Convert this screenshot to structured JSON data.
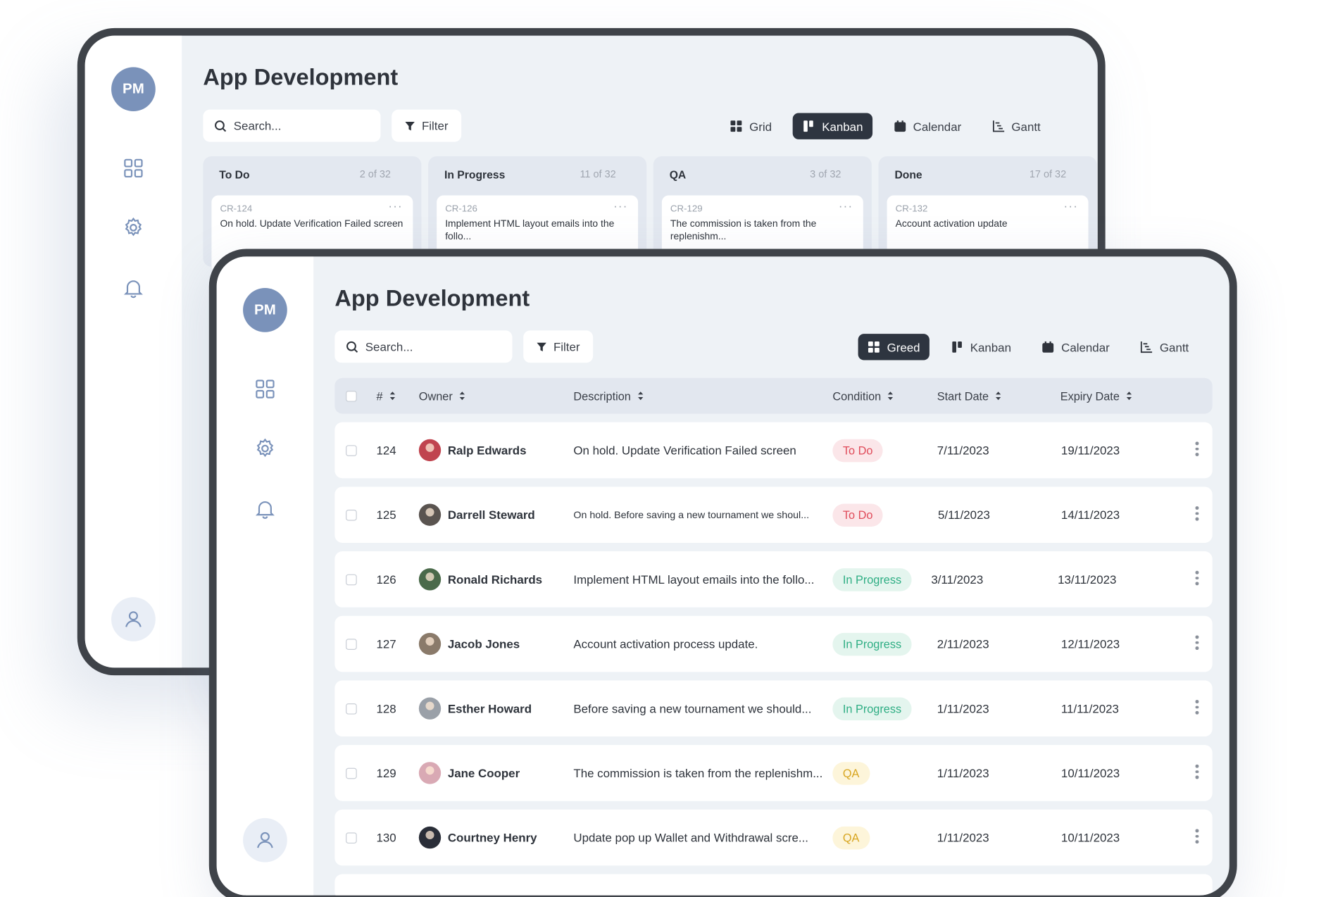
{
  "colors": {
    "frame": "#3f4349",
    "accent_avatar": "#7a92ba",
    "active_view": "#2e3540",
    "todo": "#e04b5a",
    "in_progress": "#2fae84",
    "qa": "#d8a621"
  },
  "back_window": {
    "avatar_initials": "PM",
    "title": "App Development",
    "search_placeholder": "Search...",
    "filter_label": "Filter",
    "views": [
      {
        "label": "Grid",
        "icon": "grid-icon",
        "active": false
      },
      {
        "label": "Kanban",
        "icon": "kanban-icon",
        "active": true
      },
      {
        "label": "Calendar",
        "icon": "calendar-icon",
        "active": false
      },
      {
        "label": "Gantt",
        "icon": "gantt-icon",
        "active": false
      }
    ],
    "columns": [
      {
        "title": "To Do",
        "count": "2 of 32",
        "card": {
          "id": "CR-124",
          "text": "On hold. Update Verification Failed screen"
        }
      },
      {
        "title": "In Progress",
        "count": "11 of 32",
        "card": {
          "id": "CR-126",
          "text": "Implement HTML layout emails into the follo..."
        }
      },
      {
        "title": "QA",
        "count": "3 of 32",
        "card": {
          "id": "CR-129",
          "text": "The commission is taken from the replenishm..."
        }
      },
      {
        "title": "Done",
        "count": "17 of 32",
        "card": {
          "id": "CR-132",
          "text": "Account activation update"
        }
      }
    ],
    "card_menu": "···"
  },
  "front_window": {
    "avatar_initials": "PM",
    "title": "App Development",
    "search_placeholder": "Search...",
    "filter_label": "Filter",
    "views": [
      {
        "label": "Greed",
        "icon": "grid-icon",
        "active": true
      },
      {
        "label": "Kanban",
        "icon": "kanban-icon",
        "active": false
      },
      {
        "label": "Calendar",
        "icon": "calendar-icon",
        "active": false
      },
      {
        "label": "Gantt",
        "icon": "gantt-icon",
        "active": false
      }
    ],
    "table": {
      "headers": {
        "number": "#",
        "owner": "Owner",
        "description": "Description",
        "condition": "Condition",
        "start": "Start Date",
        "expiry": "Expiry Date"
      },
      "rows": [
        {
          "id": "124",
          "owner": "Ralp Edwards",
          "description": "On hold. Update Verification Failed screen",
          "condition": "To Do",
          "status": "todo",
          "start": "7/11/2023",
          "expiry": "19/11/2023",
          "avatar_color": "#c0444f"
        },
        {
          "id": "125",
          "owner": "Darrell Steward",
          "description": "On hold. Before saving a new tournament we shoul...",
          "condition": "To Do",
          "status": "todo",
          "start": "5/11/2023",
          "expiry": "14/11/2023",
          "avatar_color": "#5a5450"
        },
        {
          "id": "126",
          "owner": "Ronald Richards",
          "description": "Implement HTML layout emails into the follo...",
          "condition": "In Progress",
          "status": "prog",
          "start": "3/11/2023",
          "expiry": "13/11/2023",
          "avatar_color": "#4a6a4a"
        },
        {
          "id": "127",
          "owner": "Jacob Jones",
          "description": "Account activation process update.",
          "condition": "In Progress",
          "status": "prog",
          "start": "2/11/2023",
          "expiry": "12/11/2023",
          "avatar_color": "#8a7a6a"
        },
        {
          "id": "128",
          "owner": "Esther Howard",
          "description": "Before saving a new tournament we should...",
          "condition": "In Progress",
          "status": "prog",
          "start": "1/11/2023",
          "expiry": "11/11/2023",
          "avatar_color": "#9aa0a8"
        },
        {
          "id": "129",
          "owner": "Jane Cooper",
          "description": "The commission is taken from the replenishm...",
          "condition": "QA",
          "status": "qa",
          "start": "1/11/2023",
          "expiry": "10/11/2023",
          "avatar_color": "#d9a9b4"
        },
        {
          "id": "130",
          "owner": "Courtney Henry",
          "description": "Update pop up Wallet  and Withdrawal scre...",
          "condition": "QA",
          "status": "qa",
          "start": "1/11/2023",
          "expiry": "10/11/2023",
          "avatar_color": "#2a2e38"
        }
      ]
    }
  }
}
